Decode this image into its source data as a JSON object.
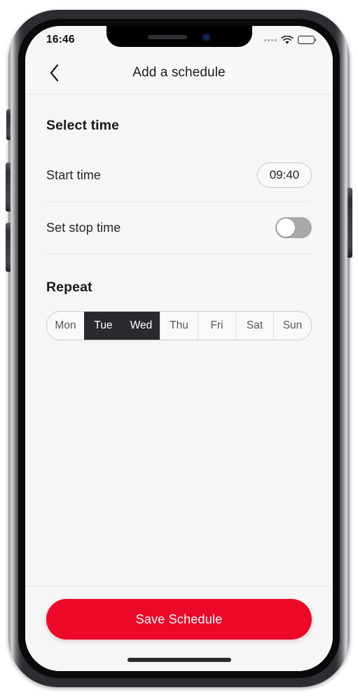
{
  "status_bar": {
    "time": "16:46",
    "signal_icon": "signal-dots-icon",
    "wifi_icon": "wifi-icon",
    "battery_icon": "battery-full-icon"
  },
  "header": {
    "back_icon": "chevron-left-icon",
    "title": "Add a schedule"
  },
  "sections": {
    "select_time": {
      "title": "Select time",
      "start_time": {
        "label": "Start time",
        "value": "09:40"
      },
      "stop_time": {
        "label": "Set stop time",
        "enabled": false
      }
    },
    "repeat": {
      "title": "Repeat",
      "days": [
        {
          "label": "Mon",
          "selected": false
        },
        {
          "label": "Tue",
          "selected": true
        },
        {
          "label": "Wed",
          "selected": true
        },
        {
          "label": "Thu",
          "selected": false
        },
        {
          "label": "Fri",
          "selected": false
        },
        {
          "label": "Sat",
          "selected": false
        },
        {
          "label": "Sun",
          "selected": false
        }
      ]
    }
  },
  "footer": {
    "save_label": "Save Schedule"
  },
  "colors": {
    "accent_red": "#ec0928",
    "selected_day": "#2a2a2e",
    "screen_background": "#f6f6f6",
    "switch_off": "#a9a9ab"
  }
}
